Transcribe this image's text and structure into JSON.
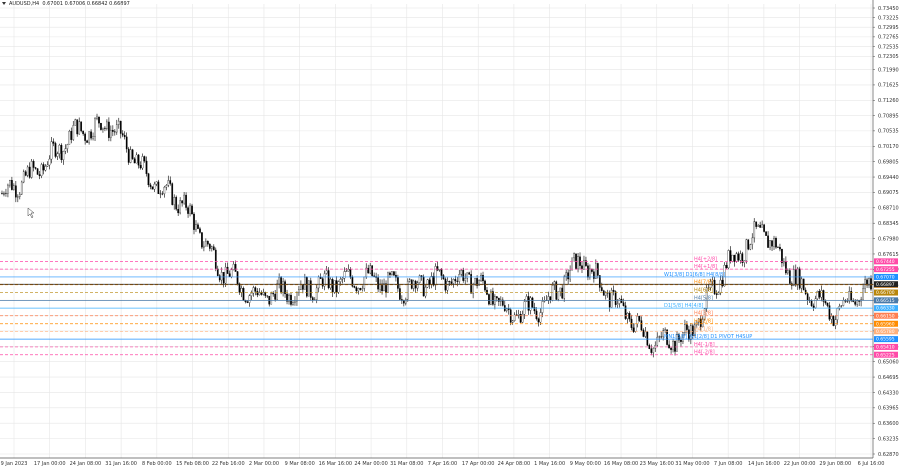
{
  "header": {
    "symbol": "AUDUSD,H4",
    "ohlc": "0.67001 0.67006 0.66842 0.66897"
  },
  "price_axis": {
    "ticks": [
      "0.73450",
      "0.73225",
      "0.72995",
      "0.72765",
      "0.72535",
      "0.72305",
      "0.71990",
      "0.71625",
      "0.71260",
      "0.70895",
      "0.70535",
      "0.70170",
      "0.69805",
      "0.69440",
      "0.69075",
      "0.68710",
      "0.68345",
      "0.67980",
      "0.67615",
      "0.67250",
      "0.66885",
      "0.66520",
      "0.66155",
      "0.65790",
      "0.65425",
      "0.65060",
      "0.64695",
      "0.64330",
      "0.63965",
      "0.63600",
      "0.63235",
      "0.62870"
    ]
  },
  "time_axis": {
    "labels": [
      "9 Jan 2023",
      "17 Jan 00:00",
      "24 Jan 08:00",
      "31 Jan 16:00",
      "8 Feb 00:00",
      "15 Feb 08:00",
      "22 Feb 16:00",
      "2 Mar 00:00",
      "9 Mar 08:00",
      "16 Mar 16:00",
      "24 Mar 00:00",
      "31 Mar 08:00",
      "7 Apr 16:00",
      "17 Apr 00:00",
      "24 Apr 08:00",
      "1 May 16:00",
      "9 May 00:00",
      "16 May 08:00",
      "23 May 16:00",
      "31 May 00:00",
      "7 Jun 08:00",
      "14 Jun 16:00",
      "22 Jun 00:00",
      "29 Jun 08:00",
      "6 Jul 16:00"
    ]
  },
  "levels": [
    {
      "label": "H4[+2/8]",
      "tag": "0.67440",
      "color": "#ff4aa8",
      "dashed": true
    },
    {
      "label": "H4[+1/8]",
      "tag": "0.67255",
      "color": "#ff4aa8",
      "dashed": true
    },
    {
      "label": "W1[3/8] D1[6/8] H4[8/8]",
      "tag": "0.67070",
      "color": "#1e90ff",
      "dashed": false
    },
    {
      "label": "H4[7/8]",
      "tag": "0.66885",
      "color": "#ff8c00",
      "dashed": true
    },
    {
      "label": "H4[6/8]",
      "tag": "0.66700",
      "color": "#b8860b",
      "dashed": true
    },
    {
      "label": "",
      "tag": "0.66897",
      "color": "#222222",
      "dashed": false
    },
    {
      "label": "H4[5/8]",
      "tag": "0.66515",
      "color": "#4a7aa8",
      "dashed": false
    },
    {
      "label": "D1[5/8] H4[4/8]",
      "tag": "0.66330",
      "color": "#3cb0ff",
      "dashed": false
    },
    {
      "label": "H4[3/8]",
      "tag": "0.66150",
      "color": "#ff7f50",
      "dashed": true
    },
    {
      "label": "H4[2/8]",
      "tag": "0.65960",
      "color": "#ff8c00",
      "dashed": true
    },
    {
      "label": "H4[1/8]",
      "tag": "0.65780",
      "color": "#ffb07a",
      "dashed": true
    },
    {
      "label": "MN1[3/8] W1[2/8] D1 PIVOT H4SUP",
      "tag": "0.65595",
      "color": "#1e90ff",
      "dashed": false
    },
    {
      "label": "H4[-1/8]",
      "tag": "0.65410",
      "color": "#ff4aa8",
      "dashed": true
    },
    {
      "label": "H4[-2/8]",
      "tag": "0.65225",
      "color": "#ff4aa8",
      "dashed": true
    }
  ],
  "chart_data": {
    "type": "candlestick",
    "title": "AUDUSD,H4",
    "x": [
      "9 Jan 2023",
      "17 Jan 00:00",
      "24 Jan 08:00",
      "31 Jan 16:00",
      "8 Feb 00:00",
      "15 Feb 08:00",
      "22 Feb 16:00",
      "2 Mar 00:00",
      "9 Mar 08:00",
      "16 Mar 16:00",
      "24 Mar 00:00",
      "31 Mar 08:00",
      "7 Apr 16:00",
      "17 Apr 00:00",
      "24 Apr 08:00",
      "1 May 16:00",
      "9 May 00:00",
      "16 May 08:00",
      "23 May 16:00",
      "31 May 00:00",
      "7 Jun 08:00",
      "14 Jun 16:00",
      "22 Jun 00:00",
      "29 Jun 08:00",
      "6 Jul 16:00"
    ],
    "close": [
      0.6905,
      0.696,
      0.705,
      0.707,
      0.6945,
      0.688,
      0.673,
      0.666,
      0.6675,
      0.669,
      0.6705,
      0.668,
      0.67,
      0.6705,
      0.662,
      0.664,
      0.675,
      0.664,
      0.655,
      0.657,
      0.6735,
      0.682,
      0.669,
      0.662,
      0.669
    ],
    "ylim": [
      0.6287,
      0.7345
    ],
    "grid": true,
    "legend": "none",
    "colors": {
      "candle": "#000000",
      "background": "#ffffff",
      "grid": "#e6e6e6"
    }
  }
}
